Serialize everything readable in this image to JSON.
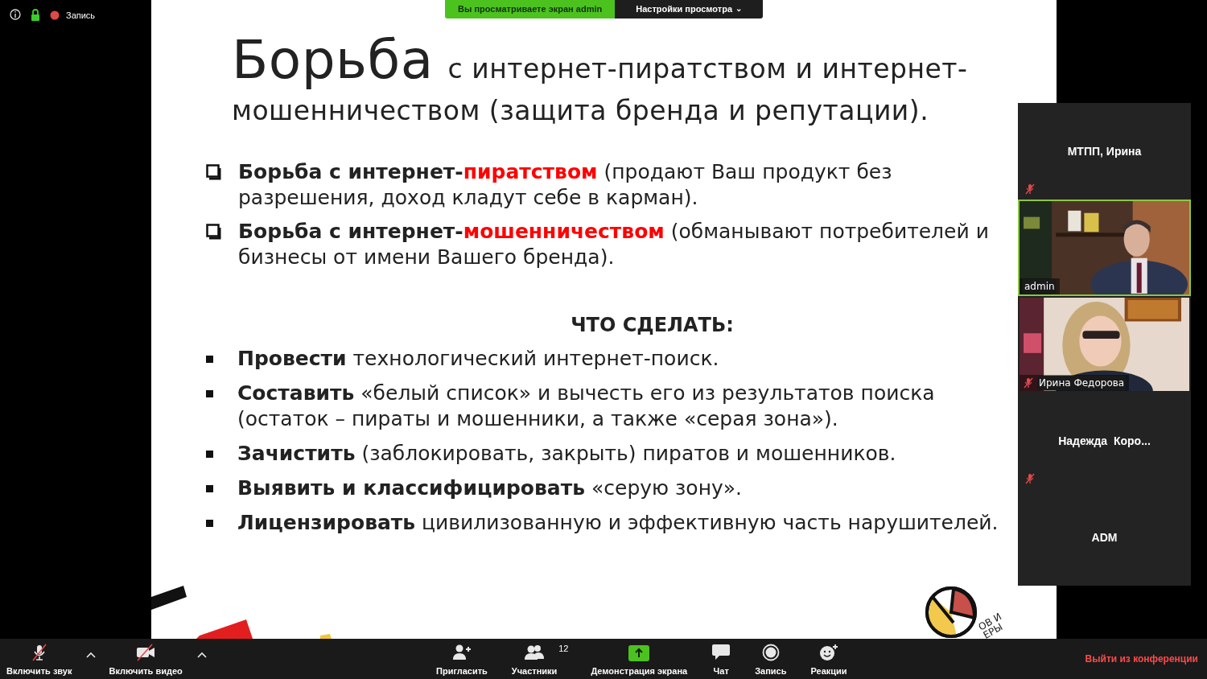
{
  "meeting_status": {
    "recording_label": "Запись",
    "encrypted": true
  },
  "share_banner": {
    "viewing": "Вы просматриваете экран admin",
    "options": "Настройки просмотра",
    "options_caret": "⌄"
  },
  "slide": {
    "title_lead": "Борьба",
    "title_rest": "с интернет-пиратством и интернет-мошенничеством (защита бренда и репутации).",
    "problems": [
      {
        "segments": [
          {
            "kind": "bold",
            "text": "Борьба с интернет-"
          },
          {
            "kind": "accent",
            "text": "пиратством"
          },
          {
            "kind": "normal",
            "text": " (продают Ваш продукт без разрешения, доход кладут себе в карман)."
          }
        ]
      },
      {
        "segments": [
          {
            "kind": "bold",
            "text": "Борьба с интернет-"
          },
          {
            "kind": "accent",
            "text": "мошенничеством"
          },
          {
            "kind": "normal",
            "text": " (обманывают потребителей и бизнесы от имени Вашего бренда)."
          }
        ]
      }
    ],
    "actions_heading": "ЧТО СДЕЛАТЬ:",
    "actions": [
      "**Провести** технологический интернет-поиск.",
      "**Составить** «белый список» и вычесть его из результатов поиска (остаток – пираты и мошенники, а также «серая зона»).",
      "**Зачистить** (заблокировать, закрыть) пиратов и мошенников.",
      "**Выявить и классифицировать** «серую зону».",
      "**Лицензировать** цивилизованную и эффективную часть нарушителей."
    ],
    "logo_text": [
      "ОВ И",
      "ЕРЫ"
    ]
  },
  "participants": [
    {
      "kind": "name",
      "name": "МТПП, Ирина",
      "muted": true,
      "speaking": false
    },
    {
      "kind": "video",
      "name": "admin",
      "muted": false,
      "speaking": true
    },
    {
      "kind": "video",
      "name": "Ирина Федорова",
      "muted": true,
      "speaking": false
    },
    {
      "kind": "name",
      "name": "Надежда  Коро...",
      "muted": true,
      "speaking": false
    },
    {
      "kind": "name",
      "name": "ADM",
      "muted": false,
      "speaking": false
    }
  ],
  "toolbar": {
    "left": [
      {
        "kind": "mic",
        "label": "Включить звук",
        "off": true
      },
      {
        "kind": "video",
        "label": "Включить видео",
        "off": true
      }
    ],
    "center": [
      {
        "kind": "invite",
        "label": "Пригласить"
      },
      {
        "kind": "participants",
        "label": "Участники",
        "count": "12"
      },
      {
        "kind": "share",
        "label": "Демонстрация экрана"
      },
      {
        "kind": "chat",
        "label": "Чат"
      },
      {
        "kind": "record",
        "label": "Запись"
      },
      {
        "kind": "reactions",
        "label": "Реакции"
      }
    ],
    "leave": "Выйти из конференции"
  }
}
